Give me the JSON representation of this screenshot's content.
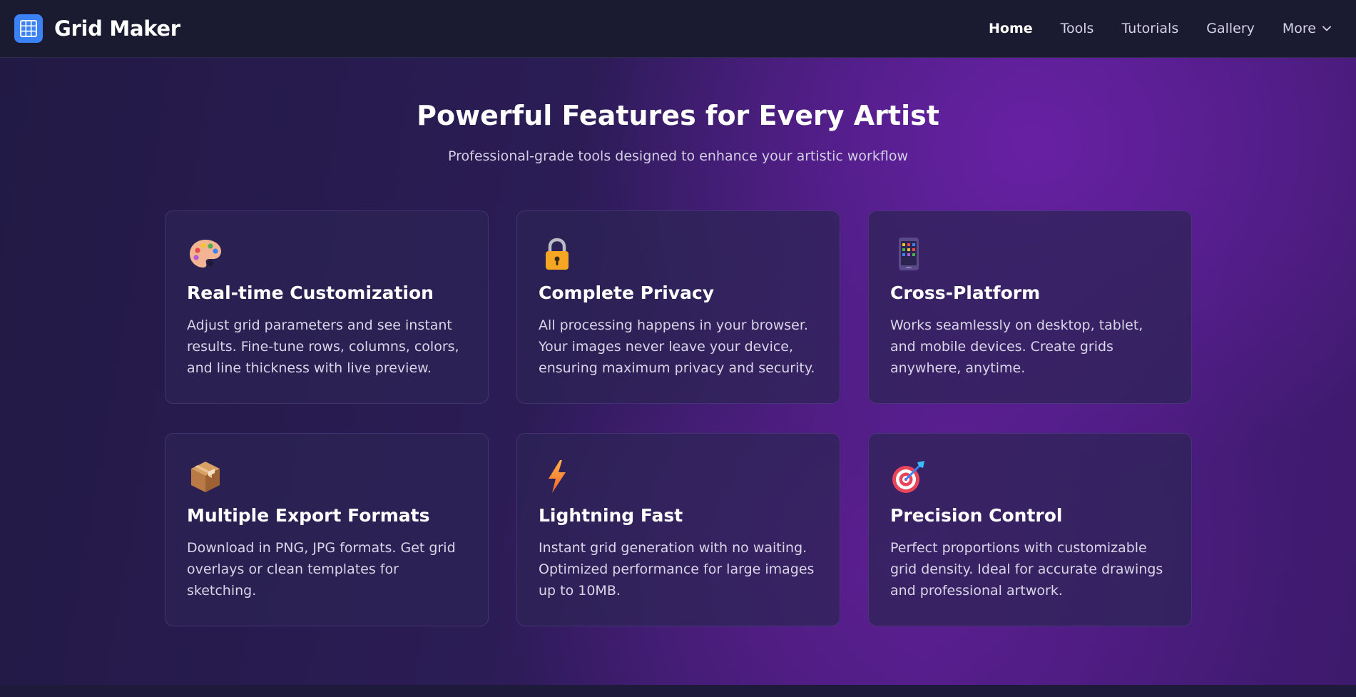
{
  "nav": {
    "brand": "Grid Maker",
    "links": [
      {
        "label": "Home",
        "active": true
      },
      {
        "label": "Tools"
      },
      {
        "label": "Tutorials"
      },
      {
        "label": "Gallery"
      },
      {
        "label": "More"
      }
    ]
  },
  "hero": {
    "title": "Powerful Features for Every Artist",
    "subtitle": "Professional-grade tools designed to enhance your artistic workflow"
  },
  "features": [
    {
      "icon": "palette-icon",
      "title": "Real-time Customization",
      "description": "Adjust grid parameters and see instant results. Fine-tune rows, columns, colors, and line thickness with live preview."
    },
    {
      "icon": "lock-icon",
      "title": "Complete Privacy",
      "description": "All processing happens in your browser. Your images never leave your device, ensuring maximum privacy and security."
    },
    {
      "icon": "tablet-icon",
      "title": "Cross-Platform",
      "description": "Works seamlessly on desktop, tablet, and mobile devices. Create grids anywhere, anytime."
    },
    {
      "icon": "package-icon",
      "title": "Multiple Export Formats",
      "description": "Download in PNG, JPG formats. Get grid overlays or clean templates for sketching."
    },
    {
      "icon": "lightning-icon",
      "title": "Lightning Fast",
      "description": "Instant grid generation with no waiting. Optimized performance for large images up to 10MB."
    },
    {
      "icon": "target-icon",
      "title": "Precision Control",
      "description": "Perfect proportions with customizable grid density. Ideal for accurate drawings and professional artwork."
    }
  ],
  "colors": {
    "accent": "#3b82f6",
    "navbar": "#1a1a31",
    "purple": "#5b1e8f"
  }
}
